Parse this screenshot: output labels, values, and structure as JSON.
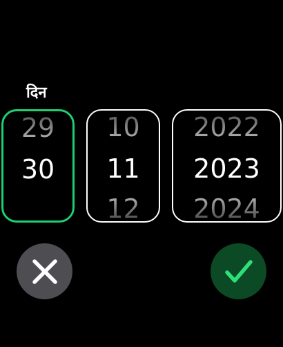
{
  "picker": {
    "label": "दिन",
    "day": {
      "prev": "29",
      "current": "30",
      "next": ""
    },
    "month": {
      "prev": "10",
      "current": "11",
      "next": "12"
    },
    "year": {
      "prev": "2022",
      "current": "2023",
      "next": "2024"
    },
    "selected_column": "day"
  },
  "actions": {
    "cancel_icon": "close-icon",
    "confirm_icon": "checkmark-icon"
  },
  "colors": {
    "background": "#000000",
    "selected_border": "#1ecf71",
    "cancel_button": "#4d4d52",
    "confirm_button": "#0b4a24",
    "confirm_check": "#2fe07a"
  }
}
